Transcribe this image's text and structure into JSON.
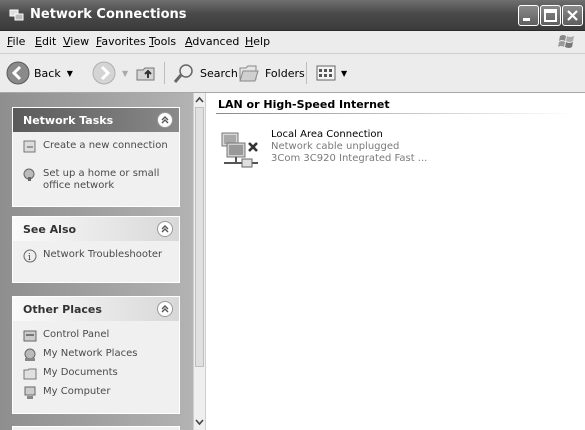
{
  "window": {
    "title": "Network Connections"
  },
  "menu": [
    "File",
    "Edit",
    "View",
    "Favorites",
    "Tools",
    "Advanced",
    "Help"
  ],
  "toolbar": {
    "back": "Back",
    "search": "Search",
    "folders": "Folders"
  },
  "left": {
    "network_tasks": {
      "title": "Network Tasks",
      "items": [
        "Create a new connection",
        "Set up a home or small office network"
      ]
    },
    "see_also": {
      "title": "See Also",
      "items": [
        "Network Troubleshooter"
      ]
    },
    "other_places": {
      "title": "Other Places",
      "items": [
        "Control Panel",
        "My Network Places",
        "My Documents",
        "My Computer"
      ]
    }
  },
  "content": {
    "group_title": "LAN or High-Speed Internet",
    "connection": {
      "name": "Local Area Connection",
      "status": "Network cable unplugged",
      "device": "3Com 3C920 Integrated Fast ..."
    }
  },
  "icons": [
    "network-connections-icon",
    "minimize-icon",
    "maximize-icon",
    "close-icon",
    "windows-logo-icon",
    "back-arrow-icon",
    "forward-arrow-icon",
    "up-folder-icon",
    "search-icon",
    "folders-icon",
    "views-icon",
    "collapse-chevron-icon",
    "new-connection-icon",
    "home-network-icon",
    "troubleshooter-icon",
    "control-panel-icon",
    "network-places-icon",
    "my-documents-icon",
    "my-computer-icon",
    "lan-connection-icon"
  ],
  "colors": {
    "titlebar": "#4a4a4a",
    "leftpane": "#a0a0a0",
    "panel": "#f0f0f0"
  }
}
